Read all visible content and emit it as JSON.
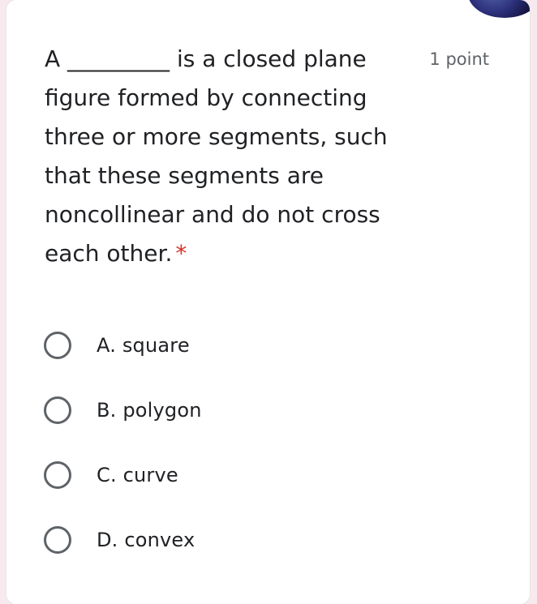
{
  "question": {
    "text": "A _________ is a closed plane figure formed by connecting three or more segments, such that these segments are noncollinear and do not cross each other.",
    "required_marker": "*",
    "points": "1 point"
  },
  "options": [
    {
      "label": "A. square",
      "selected": false
    },
    {
      "label": "B. polygon",
      "selected": false
    },
    {
      "label": "C. curve",
      "selected": false
    },
    {
      "label": "D. convex",
      "selected": false
    }
  ],
  "colors": {
    "page_background": "#f8e9ef",
    "card_background": "#ffffff",
    "text": "#202124",
    "secondary_text": "#5f6368",
    "required": "#d93025"
  }
}
